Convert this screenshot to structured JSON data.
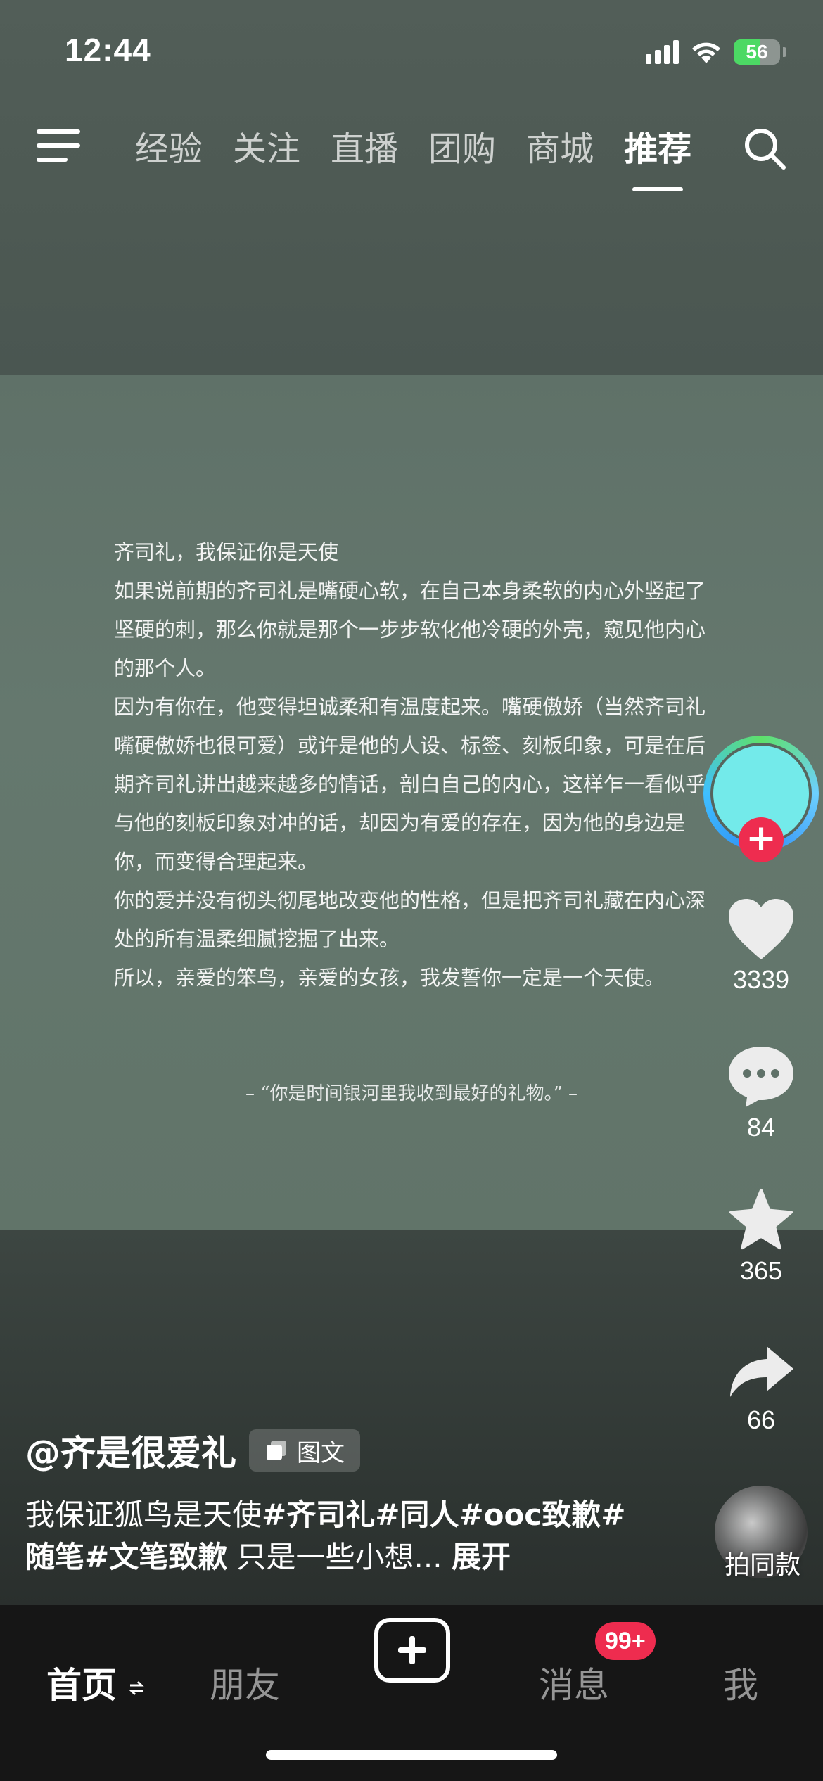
{
  "status_bar": {
    "time": "12:44",
    "battery": "56"
  },
  "top_nav": {
    "tabs": [
      {
        "label": "经验"
      },
      {
        "label": "关注"
      },
      {
        "label": "直播"
      },
      {
        "label": "团购"
      },
      {
        "label": "商城"
      },
      {
        "label": "推荐"
      }
    ],
    "active_tab": "推荐"
  },
  "post": {
    "paragraphs": [
      "齐司礼，我保证你是天使",
      "如果说前期的齐司礼是嘴硬心软，在自己本身柔软的内心外竖起了坚硬的刺，那么你就是那个一步步软化他冷硬的外壳，窥见他内心的那个人。",
      "因为有你在，他变得坦诚柔和有温度起来。嘴硬傲娇（当然齐司礼嘴硬傲娇也很可爱）或许是他的人设、标签、刻板印象，可是在后期齐司礼讲出越来越多的情话，剖白自己的内心，这样乍一看似乎与他的刻板印象对冲的话，却因为有爱的存在，因为他的身边是你，而变得合理起来。",
      "你的爱并没有彻头彻尾地改变他的性格，但是把齐司礼藏在内心深处的所有温柔细腻挖掘了出来。",
      "所以，亲爱的笨鸟，亲爱的女孩，我发誓你一定是一个天使。"
    ],
    "quote": "– “你是时间银河里我收到最好的礼物。” –"
  },
  "actions": {
    "likes": "3339",
    "comments": "84",
    "favorites": "365",
    "shares": "66",
    "same_style_label": "拍同款"
  },
  "author": {
    "name": "@齐是很爱礼",
    "badge": "图文"
  },
  "caption": {
    "text": "我保证狐鸟是天使",
    "tags": "#齐司礼#同人#ooc致歉#随笔#文笔致歉",
    "rest": " 只是一些小想... ",
    "expand": "展开"
  },
  "bottom_nav": {
    "home": "首页",
    "friends": "朋友",
    "messages": "消息",
    "messages_badge": "99+",
    "me": "我"
  },
  "colors": {
    "accent": "#ee2c4f",
    "card_bg": "#627469"
  }
}
